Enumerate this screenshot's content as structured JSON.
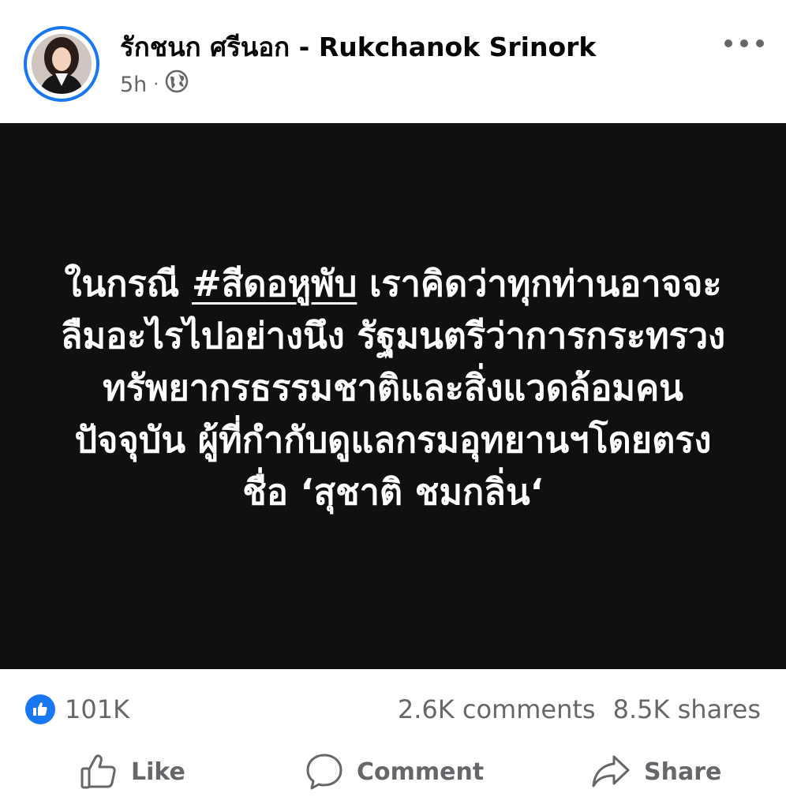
{
  "post": {
    "author": "รักชนก ศรีนอก - Rukchanok Srinork",
    "time": "5h",
    "separator": "·",
    "privacy_icon": "globe-icon",
    "more_icon": "ellipsis-icon"
  },
  "image_text": {
    "before_hashtag": "ในกรณี ",
    "hashtag": "#สีดอหูพับ",
    "after_hashtag": " เราคิดว่าทุกท่านอาจจะลืมอะไรไปอย่างนึง รัฐมนตรีว่าการกระทรวงทรัพยากรธรรมชาติและสิ่งแวดล้อมคนปัจจุบัน ผู้ที่กำกับดูแลกรมอุทยานฯโดยตรง ชื่อ ‘สุชาติ ชมกลิ่น‘"
  },
  "stats": {
    "likes": "101K",
    "comments": "2.6K comments",
    "shares": "8.5K shares"
  },
  "actions": {
    "like": "Like",
    "comment": "Comment",
    "share": "Share"
  },
  "colors": {
    "accent": "#1877f2",
    "secondary_text": "#65676b",
    "image_background": "#101010"
  }
}
